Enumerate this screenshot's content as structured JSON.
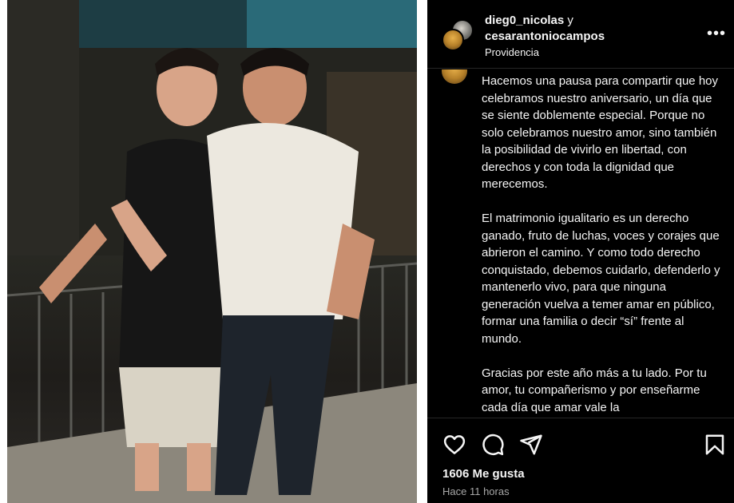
{
  "post": {
    "authors": {
      "first": "dieg0_nicolas",
      "joiner": "y",
      "second": "cesarantoniocampos"
    },
    "location": "Providencia",
    "more_label": "•••",
    "caption": {
      "paragraph_1": "Hacemos una pausa para compartir que hoy celebramos nuestro aniversario, un día que se siente doblemente especial. Porque no solo celebramos nuestro amor, sino también la posibilidad de vivirlo en libertad, con derechos y con toda la dignidad que merecemos.",
      "paragraph_2": "El matrimonio igualitario es un derecho ganado, fruto de luchas, voces y corajes que abrieron el camino. Y como todo derecho conquistado, debemos cuidarlo, defenderlo y mantenerlo vivo, para que ninguna generación vuelva a temer amar en público, formar una familia o decir “sí” frente al mundo.",
      "paragraph_3": "Gracias por este año más a tu lado. Por tu amor, tu compañerismo y por enseñarme cada día que amar vale la"
    },
    "likes": "1606 Me gusta",
    "time_ago": "Hace 11 horas"
  },
  "icons": {
    "like": "heart-icon",
    "comment": "comment-icon",
    "share": "send-icon",
    "save": "bookmark-icon"
  },
  "colors": {
    "background": "#000000",
    "text": "#f5f5f5",
    "muted": "#a8a8a8",
    "divider": "#262626"
  }
}
